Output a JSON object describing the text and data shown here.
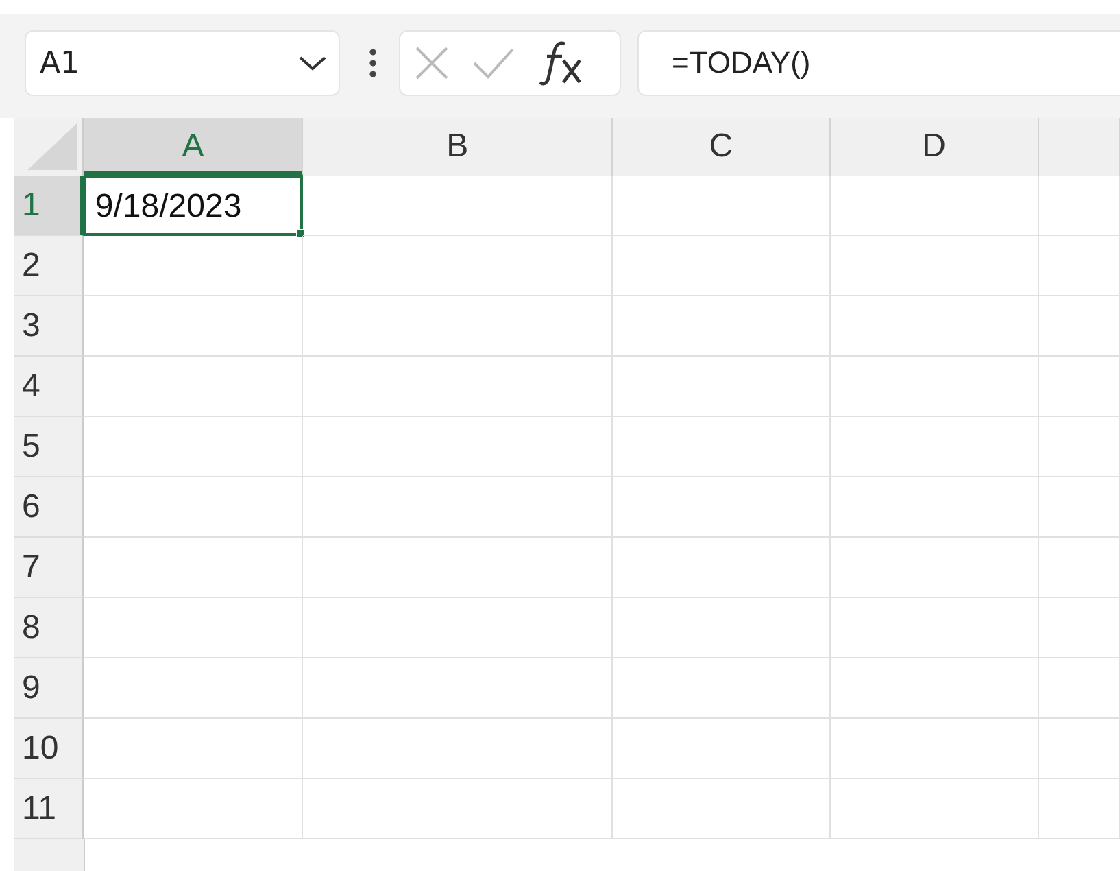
{
  "name_box": {
    "value": "A1"
  },
  "formula_bar": {
    "value": "=TODAY()"
  },
  "columns": [
    {
      "label": "A",
      "selected": true
    },
    {
      "label": "B",
      "selected": false
    },
    {
      "label": "C",
      "selected": false
    },
    {
      "label": "D",
      "selected": false
    }
  ],
  "rows": [
    {
      "label": "1",
      "selected": true,
      "cells": [
        "9/18/2023"
      ]
    },
    {
      "label": "2",
      "selected": false,
      "cells": []
    },
    {
      "label": "3",
      "selected": false,
      "cells": []
    },
    {
      "label": "4",
      "selected": false,
      "cells": []
    },
    {
      "label": "5",
      "selected": false,
      "cells": []
    },
    {
      "label": "6",
      "selected": false,
      "cells": []
    },
    {
      "label": "7",
      "selected": false,
      "cells": []
    },
    {
      "label": "8",
      "selected": false,
      "cells": []
    },
    {
      "label": "9",
      "selected": false,
      "cells": []
    },
    {
      "label": "10",
      "selected": false,
      "cells": []
    },
    {
      "label": "11",
      "selected": false,
      "cells": []
    }
  ]
}
